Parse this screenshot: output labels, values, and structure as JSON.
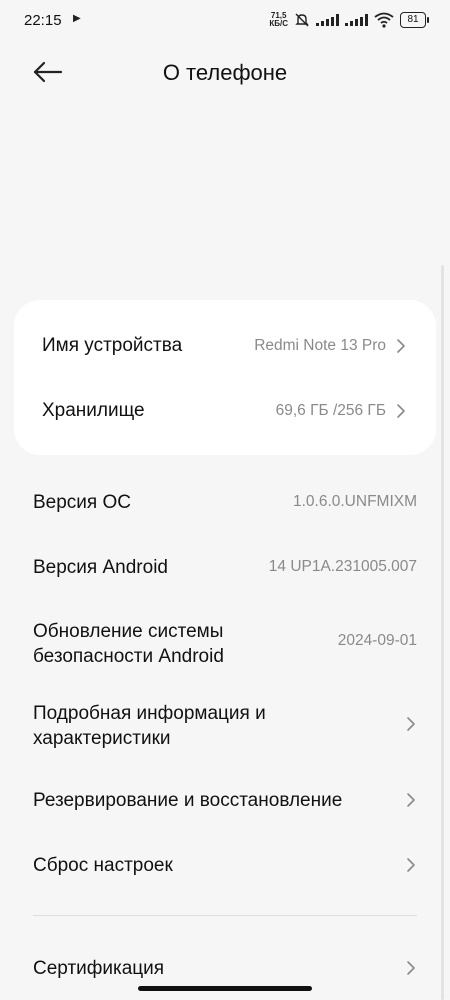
{
  "status_bar": {
    "time": "22:15",
    "net_speed_value": "71,5",
    "net_speed_unit": "КБ/С",
    "battery": "81"
  },
  "header": {
    "title": "О телефоне"
  },
  "card": {
    "device_name_label": "Имя устройства",
    "device_name_value": "Redmi Note 13 Pro",
    "storage_label": "Хранилище",
    "storage_value": "69,6 ГБ /256 ГБ"
  },
  "info": {
    "os_version_label": "Версия ОС",
    "os_version_value": "1.0.6.0.UNFMIXM",
    "android_version_label": "Версия Android",
    "android_version_value": "14 UP1A.231005.007",
    "security_update_label_line1": "Обновление системы",
    "security_update_label_line2": "безопасности Android",
    "security_update_value": "2024-09-01",
    "specs_label_line1": "Подробная информация и",
    "specs_label_line2": "характеристики",
    "backup_label": "Резервирование и восстановление",
    "reset_label": "Сброс настроек",
    "certification_label": "Сертификация"
  },
  "colors": {
    "background": "#f6f6f6",
    "card": "#ffffff",
    "secondary_text": "#8a8a8a"
  }
}
